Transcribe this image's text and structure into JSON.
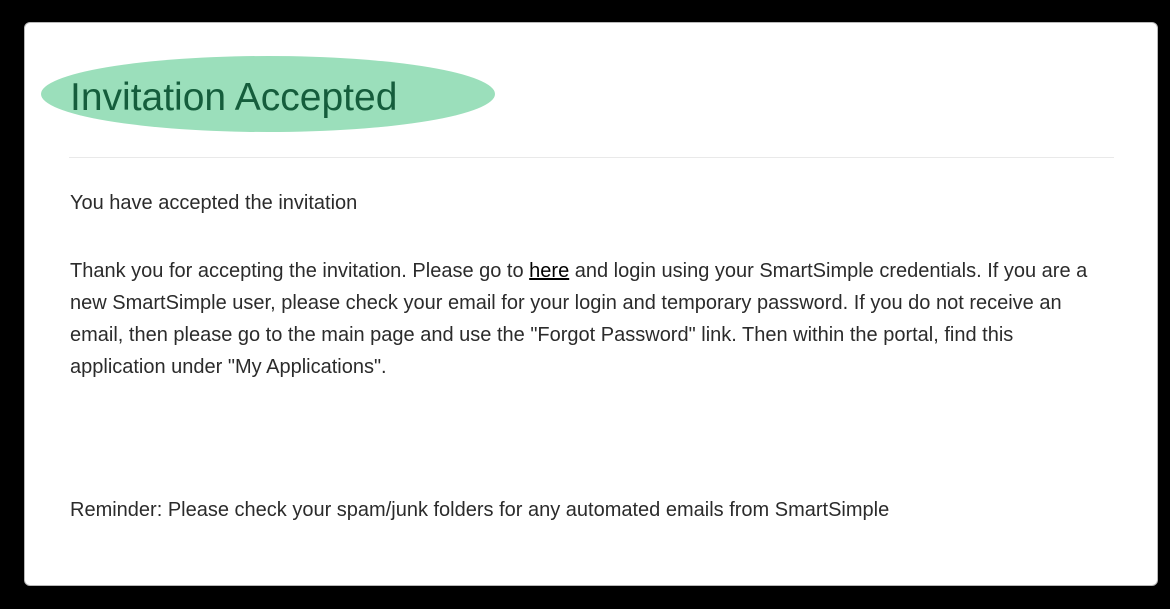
{
  "page": {
    "title": "Invitation Accepted",
    "subtitle": "You have accepted the invitation",
    "message": {
      "part1": "Thank you for accepting the invitation. Please go to ",
      "link_text": "here",
      "part2": " and login using your SmartSimple credentials. If you are a new SmartSimple user, please check your email for your login and temporary password. If you do not receive an email, then please go to the main page and use the \"Forgot Password\" link. Then within the portal, find this application under \"My Applications\"."
    },
    "reminder": "Reminder: Please check your spam/junk folders for any automated emails from SmartSimple"
  },
  "colors": {
    "title_highlight": "#9bdfbb",
    "title_text": "#155d3c",
    "body_text": "#2b2b2b",
    "frame_border": "#000000"
  }
}
